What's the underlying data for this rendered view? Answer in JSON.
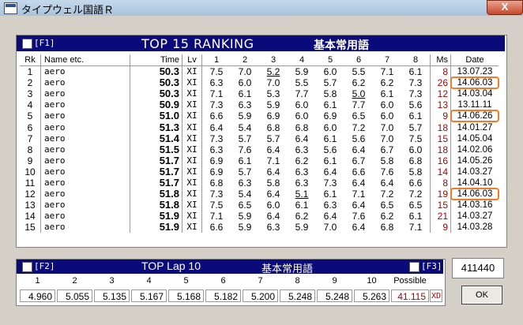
{
  "window": {
    "title": "タイプウェル国語Ｒ",
    "close_label": "X"
  },
  "ranking": {
    "f1_label": "[F1]",
    "title": "TOP 15  RANKING",
    "subtitle": "基本常用語",
    "columns": [
      "Rk",
      "Name etc.",
      "Time",
      "Lv",
      "1",
      "2",
      "3",
      "4",
      "5",
      "6",
      "7",
      "8",
      "Ms",
      "Date"
    ],
    "rows": [
      {
        "rk": "1",
        "name": "aero",
        "time": "50.3",
        "lv": "XI",
        "k": [
          "7.5",
          "7.0",
          "5.2",
          "5.9",
          "6.0",
          "5.5",
          "7.1",
          "6.1"
        ],
        "ms": "8",
        "date": "13.07.23"
      },
      {
        "rk": "2",
        "name": "aero",
        "time": "50.3",
        "lv": "XI",
        "k": [
          "6.3",
          "6.0",
          "7.0",
          "5.5",
          "5.7",
          "6.2",
          "6.2",
          "7.3"
        ],
        "ms": "26",
        "date": "14.06.03"
      },
      {
        "rk": "3",
        "name": "aero",
        "time": "50.3",
        "lv": "XI",
        "k": [
          "7.1",
          "6.1",
          "5.3",
          "7.7",
          "5.8",
          "5.0",
          "6.1",
          "7.3"
        ],
        "ms": "12",
        "date": "14.03.04"
      },
      {
        "rk": "4",
        "name": "aero",
        "time": "50.9",
        "lv": "XI",
        "k": [
          "7.3",
          "6.3",
          "5.9",
          "6.0",
          "6.1",
          "7.7",
          "6.0",
          "5.6"
        ],
        "ms": "13",
        "date": "13.11.11"
      },
      {
        "rk": "5",
        "name": "aero",
        "time": "51.0",
        "lv": "XI",
        "k": [
          "6.6",
          "5.9",
          "6.9",
          "6.0",
          "6.9",
          "6.5",
          "6.0",
          "6.1"
        ],
        "ms": "9",
        "date": "14.06.26"
      },
      {
        "rk": "6",
        "name": "aero",
        "time": "51.3",
        "lv": "XI",
        "k": [
          "6.4",
          "5.4",
          "6.8",
          "6.8",
          "6.0",
          "7.2",
          "7.0",
          "5.7"
        ],
        "ms": "18",
        "date": "14.01.27"
      },
      {
        "rk": "7",
        "name": "aero",
        "time": "51.4",
        "lv": "XI",
        "k": [
          "7.3",
          "5.7",
          "5.7",
          "6.4",
          "6.1",
          "5.6",
          "7.0",
          "7.5"
        ],
        "ms": "15",
        "date": "14.05.04"
      },
      {
        "rk": "8",
        "name": "aero",
        "time": "51.5",
        "lv": "XI",
        "k": [
          "6.3",
          "7.6",
          "6.4",
          "6.3",
          "5.6",
          "6.4",
          "6.7",
          "6.0"
        ],
        "ms": "18",
        "date": "14.02.06"
      },
      {
        "rk": "9",
        "name": "aero",
        "time": "51.7",
        "lv": "XI",
        "k": [
          "6.9",
          "6.1",
          "7.1",
          "6.2",
          "6.1",
          "6.7",
          "5.8",
          "6.8"
        ],
        "ms": "16",
        "date": "14.05.26"
      },
      {
        "rk": "10",
        "name": "aero",
        "time": "51.7",
        "lv": "XI",
        "k": [
          "6.9",
          "5.7",
          "6.4",
          "6.3",
          "6.4",
          "6.6",
          "7.6",
          "5.8"
        ],
        "ms": "14",
        "date": "14.03.27"
      },
      {
        "rk": "11",
        "name": "aero",
        "time": "51.7",
        "lv": "XI",
        "k": [
          "6.8",
          "6.3",
          "5.8",
          "6.3",
          "7.3",
          "6.4",
          "6.4",
          "6.6"
        ],
        "ms": "8",
        "date": "14.04.10"
      },
      {
        "rk": "12",
        "name": "aero",
        "time": "51.8",
        "lv": "XI",
        "k": [
          "7.3",
          "5.4",
          "6.4",
          "5.1",
          "6.1",
          "7.1",
          "7.2",
          "7.2"
        ],
        "ms": "19",
        "date": "14.06.03"
      },
      {
        "rk": "13",
        "name": "aero",
        "time": "51.8",
        "lv": "XI",
        "k": [
          "7.5",
          "6.5",
          "6.0",
          "6.1",
          "6.3",
          "6.4",
          "6.5",
          "6.5"
        ],
        "ms": "15",
        "date": "14.03.16"
      },
      {
        "rk": "14",
        "name": "aero",
        "time": "51.9",
        "lv": "XI",
        "k": [
          "7.1",
          "5.9",
          "6.4",
          "6.2",
          "6.4",
          "7.6",
          "6.2",
          "6.1"
        ],
        "ms": "21",
        "date": "14.03.27"
      },
      {
        "rk": "15",
        "name": "aero",
        "time": "51.9",
        "lv": "XI",
        "k": [
          "6.6",
          "5.9",
          "6.3",
          "5.9",
          "7.0",
          "6.4",
          "6.8",
          "7.1"
        ],
        "ms": "9",
        "date": "14.03.28"
      }
    ],
    "underlined": [
      [
        0,
        2
      ],
      [
        2,
        5
      ],
      [
        11,
        3
      ]
    ],
    "highlighted_rows": [
      1,
      4,
      11
    ],
    "highlight_color": "#f07c2a",
    "ms_color": "#b00000",
    "header_bg": "#0a0a7a"
  },
  "lap": {
    "f2_label": "[F2]",
    "title": "TOP Lap 10",
    "subtitle": "基本常用語",
    "f3_label": "[F3]",
    "columns": [
      "1",
      "2",
      "3",
      "4",
      "5",
      "6",
      "7",
      "8",
      "9",
      "10",
      "Possible"
    ],
    "values": [
      "4.960",
      "5.055",
      "5.135",
      "5.167",
      "5.168",
      "5.182",
      "5.200",
      "5.248",
      "5.248",
      "5.263",
      "41.115"
    ],
    "level": "XD"
  },
  "score": "411440",
  "ok_label": "OK"
}
